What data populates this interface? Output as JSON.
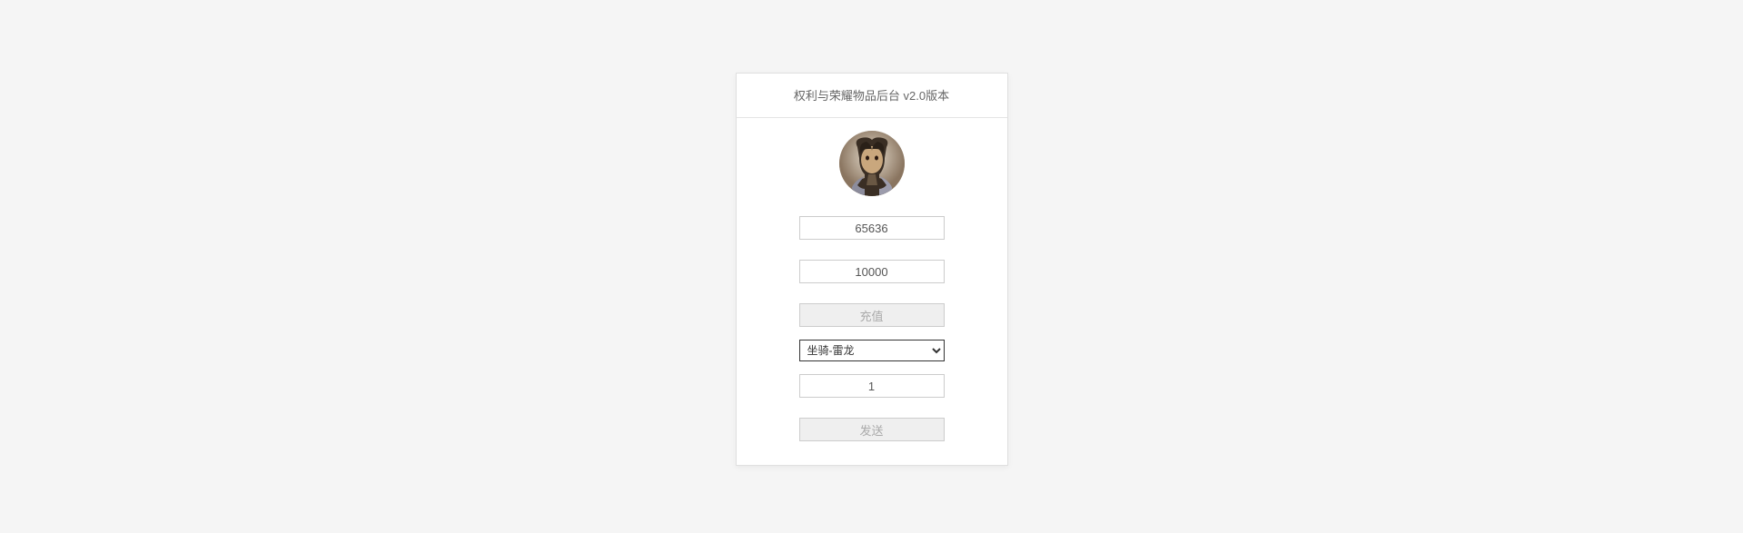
{
  "header": {
    "title": "权利与荣耀物品后台 v2.0版本"
  },
  "form": {
    "input1_value": "65636",
    "input2_value": "10000",
    "recharge_btn": "充值",
    "select_value": "坐骑-雷龙",
    "quantity_value": "1",
    "send_btn": "发送"
  }
}
